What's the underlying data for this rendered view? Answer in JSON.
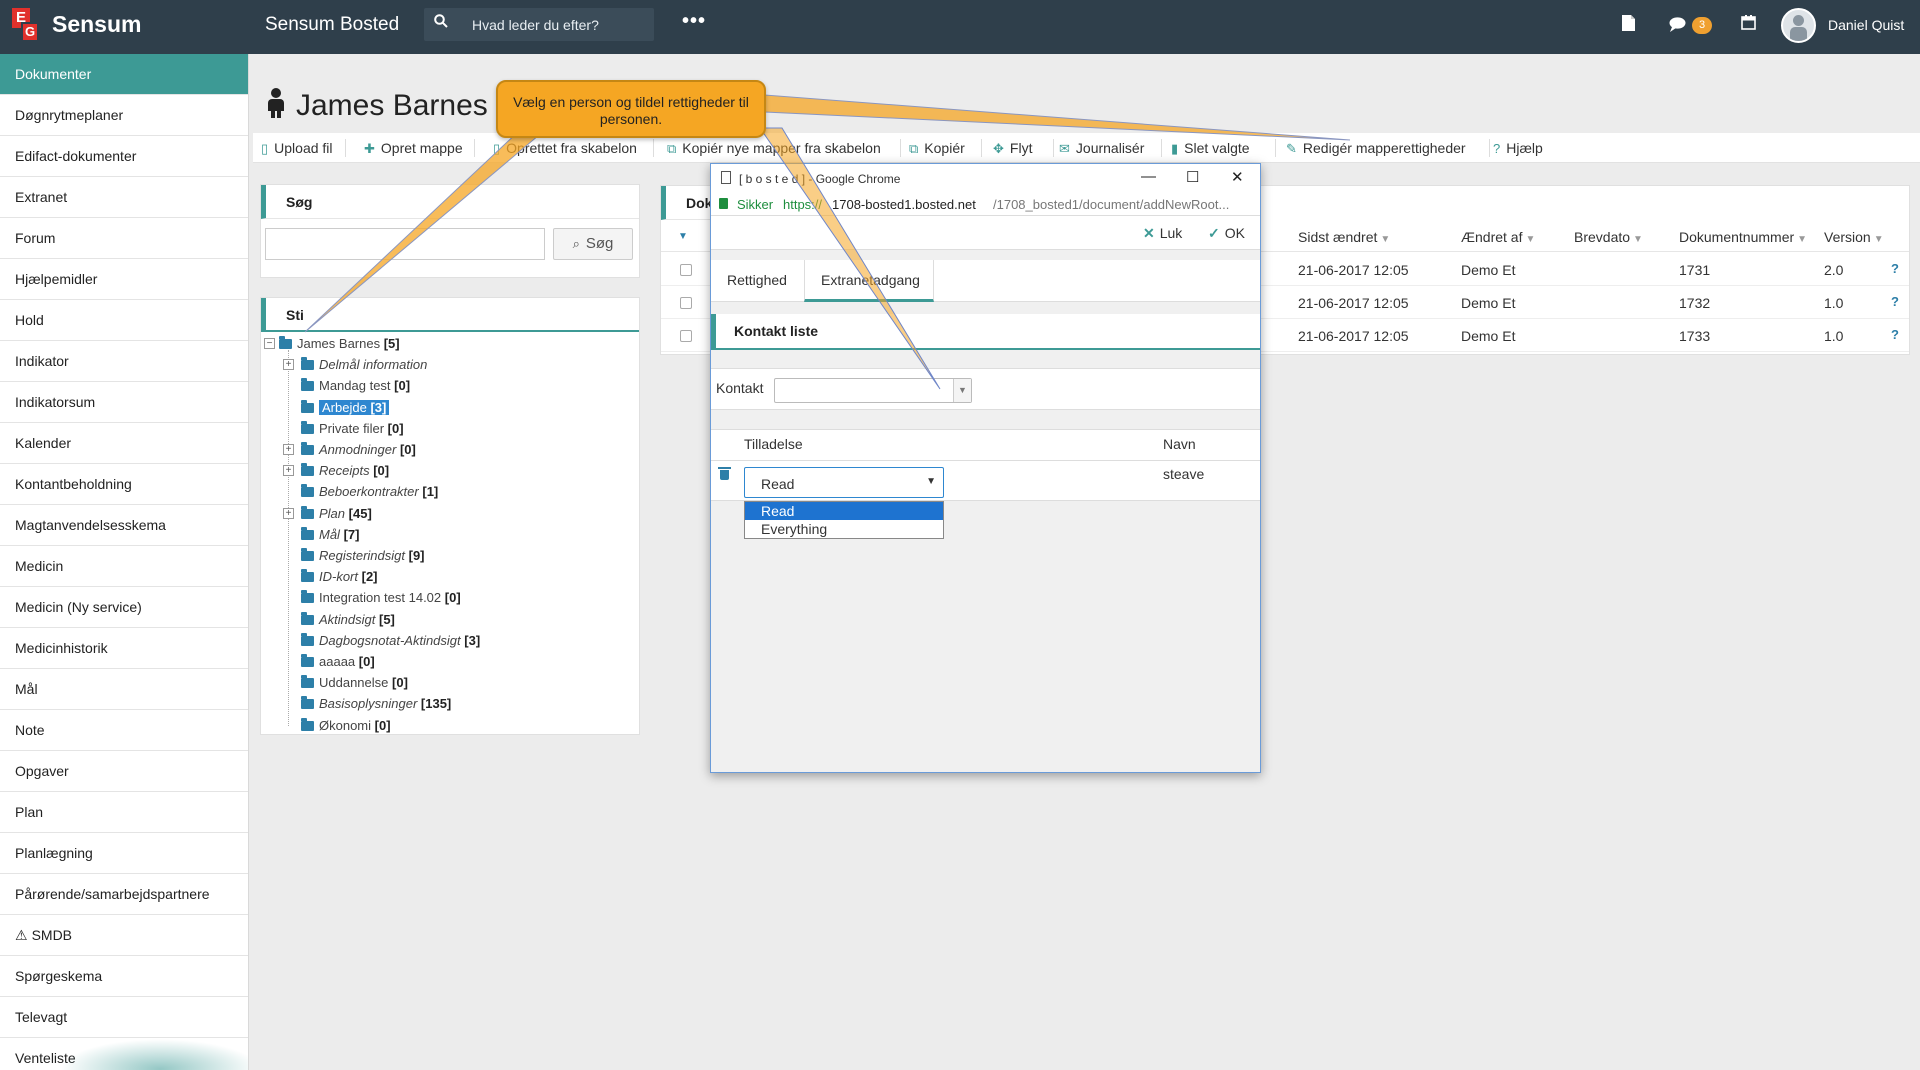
{
  "topbar": {
    "brand": "Sensum",
    "app_title": "Sensum Bosted",
    "search_placeholder": "Hvad leder du efter?",
    "more_label": "•••",
    "messages_badge": "3",
    "user_name": "Daniel Quist"
  },
  "sidebar": {
    "items": [
      "Dokumenter",
      "Døgnrytmeplaner",
      "Edifact-dokumenter",
      "Extranet",
      "Forum",
      "Hjælpemidler",
      "Hold",
      "Indikator",
      "Indikatorsum",
      "Kalender",
      "Kontantbeholdning",
      "Magtanvendelsesskema",
      "Medicin",
      "Medicin (Ny service)",
      "Medicinhistorik",
      "Mål",
      "Note",
      "Opgaver",
      "Plan",
      "Planlægning",
      "Pårørende/samarbejdspartnere",
      "SMDB",
      "Spørgeskema",
      "Televagt",
      "Venteliste"
    ],
    "smdb_warning": "⚠"
  },
  "page": {
    "title": "James Barnes"
  },
  "toolbar": {
    "upload": "Upload fil",
    "create_folder": "Opret mappe",
    "create_template": "Oprettet fra skabelon",
    "copy_template": "Kopiér nye mapper fra skabelon",
    "copy": "Kopiér",
    "move": "Flyt",
    "journal": "Journalisér",
    "delete": "Slet valgte",
    "edit_rights": "Redigér mapperettigheder",
    "help": "Hjælp"
  },
  "search_panel": {
    "title": "Søg",
    "button": "Søg",
    "value": ""
  },
  "path_panel": {
    "title": "Sti",
    "root": {
      "name": "James Barnes",
      "count": "[5]"
    },
    "items": [
      {
        "name": "Delmål information",
        "count": "",
        "italic": true,
        "expand": true
      },
      {
        "name": "Mandag test",
        "count": "[0]",
        "italic": false,
        "expand": false
      },
      {
        "name": "Arbejde",
        "count": "[3]",
        "italic": false,
        "expand": false,
        "selected": true
      },
      {
        "name": "Private filer",
        "count": "[0]",
        "italic": false,
        "expand": false
      },
      {
        "name": "Anmodninger",
        "count": "[0]",
        "italic": true,
        "expand": true
      },
      {
        "name": "Receipts",
        "count": "[0]",
        "italic": true,
        "expand": true
      },
      {
        "name": "Beboerkontrakter",
        "count": "[1]",
        "italic": true,
        "expand": false
      },
      {
        "name": "Plan",
        "count": "[45]",
        "italic": true,
        "expand": true
      },
      {
        "name": "Mål",
        "count": "[7]",
        "italic": true,
        "expand": false
      },
      {
        "name": "Registerindsigt",
        "count": "[9]",
        "italic": true,
        "expand": false
      },
      {
        "name": "ID-kort",
        "count": "[2]",
        "italic": true,
        "expand": false
      },
      {
        "name": "Integration test 14.02",
        "count": "[0]",
        "italic": false,
        "expand": false
      },
      {
        "name": "Aktindsigt",
        "count": "[5]",
        "italic": true,
        "expand": false
      },
      {
        "name": "Dagbogsnotat-Aktindsigt",
        "count": "[3]",
        "italic": true,
        "expand": false
      },
      {
        "name": "aaaaa",
        "count": "[0]",
        "italic": false,
        "expand": false
      },
      {
        "name": "Uddannelse",
        "count": "[0]",
        "italic": false,
        "expand": false
      },
      {
        "name": "Basisoplysninger",
        "count": "[135]",
        "italic": true,
        "expand": false
      },
      {
        "name": "Økonomi",
        "count": "[0]",
        "italic": false,
        "expand": false
      }
    ]
  },
  "documents": {
    "title": "Dok",
    "columns": [
      "Sidst ændret",
      "Ændret af",
      "Brevdato",
      "Dokumentnummer",
      "Version"
    ],
    "rows": [
      {
        "changed": "21-06-2017 12:05",
        "by": "Demo Et",
        "date": "",
        "number": "1731",
        "version": "2.0"
      },
      {
        "changed": "21-06-2017 12:05",
        "by": "Demo Et",
        "date": "",
        "number": "1732",
        "version": "1.0"
      },
      {
        "changed": "21-06-2017 12:05",
        "by": "Demo Et",
        "date": "",
        "number": "1733",
        "version": "1.0"
      }
    ],
    "help_glyph": "?"
  },
  "dialog": {
    "window_title": "[ b o s t e d ] - Google Chrome",
    "secure_label": "Sikker",
    "url_scheme": "https://",
    "url_host": "1708-bosted1.bosted.net",
    "url_path": "/1708_bosted1/document/addNewRoot...",
    "close_label": "Luk",
    "ok_label": "OK",
    "tabs": [
      "Rettighed",
      "Extranetadgang"
    ],
    "section_title": "Kontakt liste",
    "contact_label": "Kontakt",
    "contact_value": "",
    "col_permission": "Tilladelse",
    "col_name": "Navn",
    "row": {
      "permission": "Read",
      "name": "steave"
    },
    "options": [
      "Read",
      "Everything"
    ],
    "selected_option": "Read"
  },
  "callout": {
    "text": "Vælg en person og tildel rettigheder til personen."
  },
  "colors": {
    "accent": "#3d9a95",
    "topbar": "#2f3f4b",
    "callout": "#f5a623",
    "folder": "#2d7fa8"
  }
}
